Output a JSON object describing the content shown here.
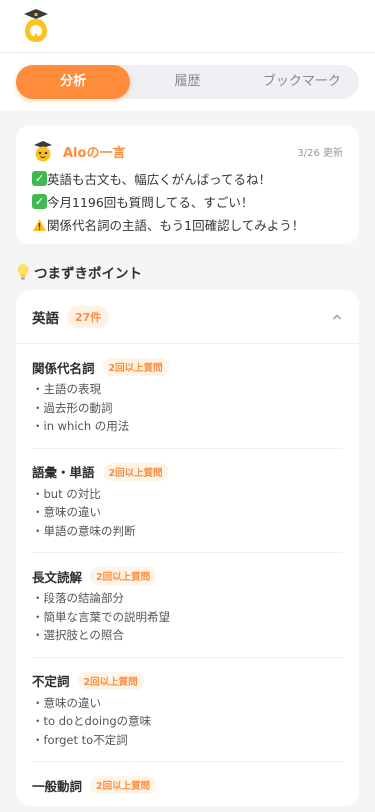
{
  "tabs": [
    {
      "label": "分析",
      "active": true
    },
    {
      "label": "履歴",
      "active": false
    },
    {
      "label": "ブックマーク",
      "active": false
    }
  ],
  "alo": {
    "title": "Aloの一言",
    "date": "3/26 更新",
    "lines": [
      {
        "icon": "check-icon",
        "text": "英語も古文も、幅広くがんばってるね！"
      },
      {
        "icon": "check-icon",
        "text": "今月1196回も質問してる、すごい！"
      },
      {
        "icon": "warning-icon",
        "text": "関係代名詞の主語、もう1回確認してみよう！"
      }
    ]
  },
  "stumble": {
    "title": "つまずきポイント",
    "subject": "英語",
    "count": "27件",
    "topics": [
      {
        "name": "関係代名詞",
        "badge": "2回以上質問",
        "items": [
          "・主語の表現",
          "・過去形の動詞",
          "・in which の用法"
        ]
      },
      {
        "name": "語彙・単語",
        "badge": "2回以上質問",
        "items": [
          "・but の対比",
          "・意味の違い",
          "・単語の意味の判断"
        ]
      },
      {
        "name": "長文読解",
        "badge": "2回以上質問",
        "items": [
          "・段落の結論部分",
          "・簡単な言葉での説明希望",
          "・選択肢との照合"
        ]
      },
      {
        "name": "不定詞",
        "badge": "2回以上質問",
        "items": [
          "・意味の違い",
          "・to doとdoingの意味",
          "・forget to不定詞"
        ]
      },
      {
        "name": "一般動詞",
        "badge": "2回以上質問",
        "items": []
      }
    ]
  },
  "colors": {
    "accent": "#ff8c3a",
    "check": "#3fb950",
    "background": "#f4f5f7"
  }
}
